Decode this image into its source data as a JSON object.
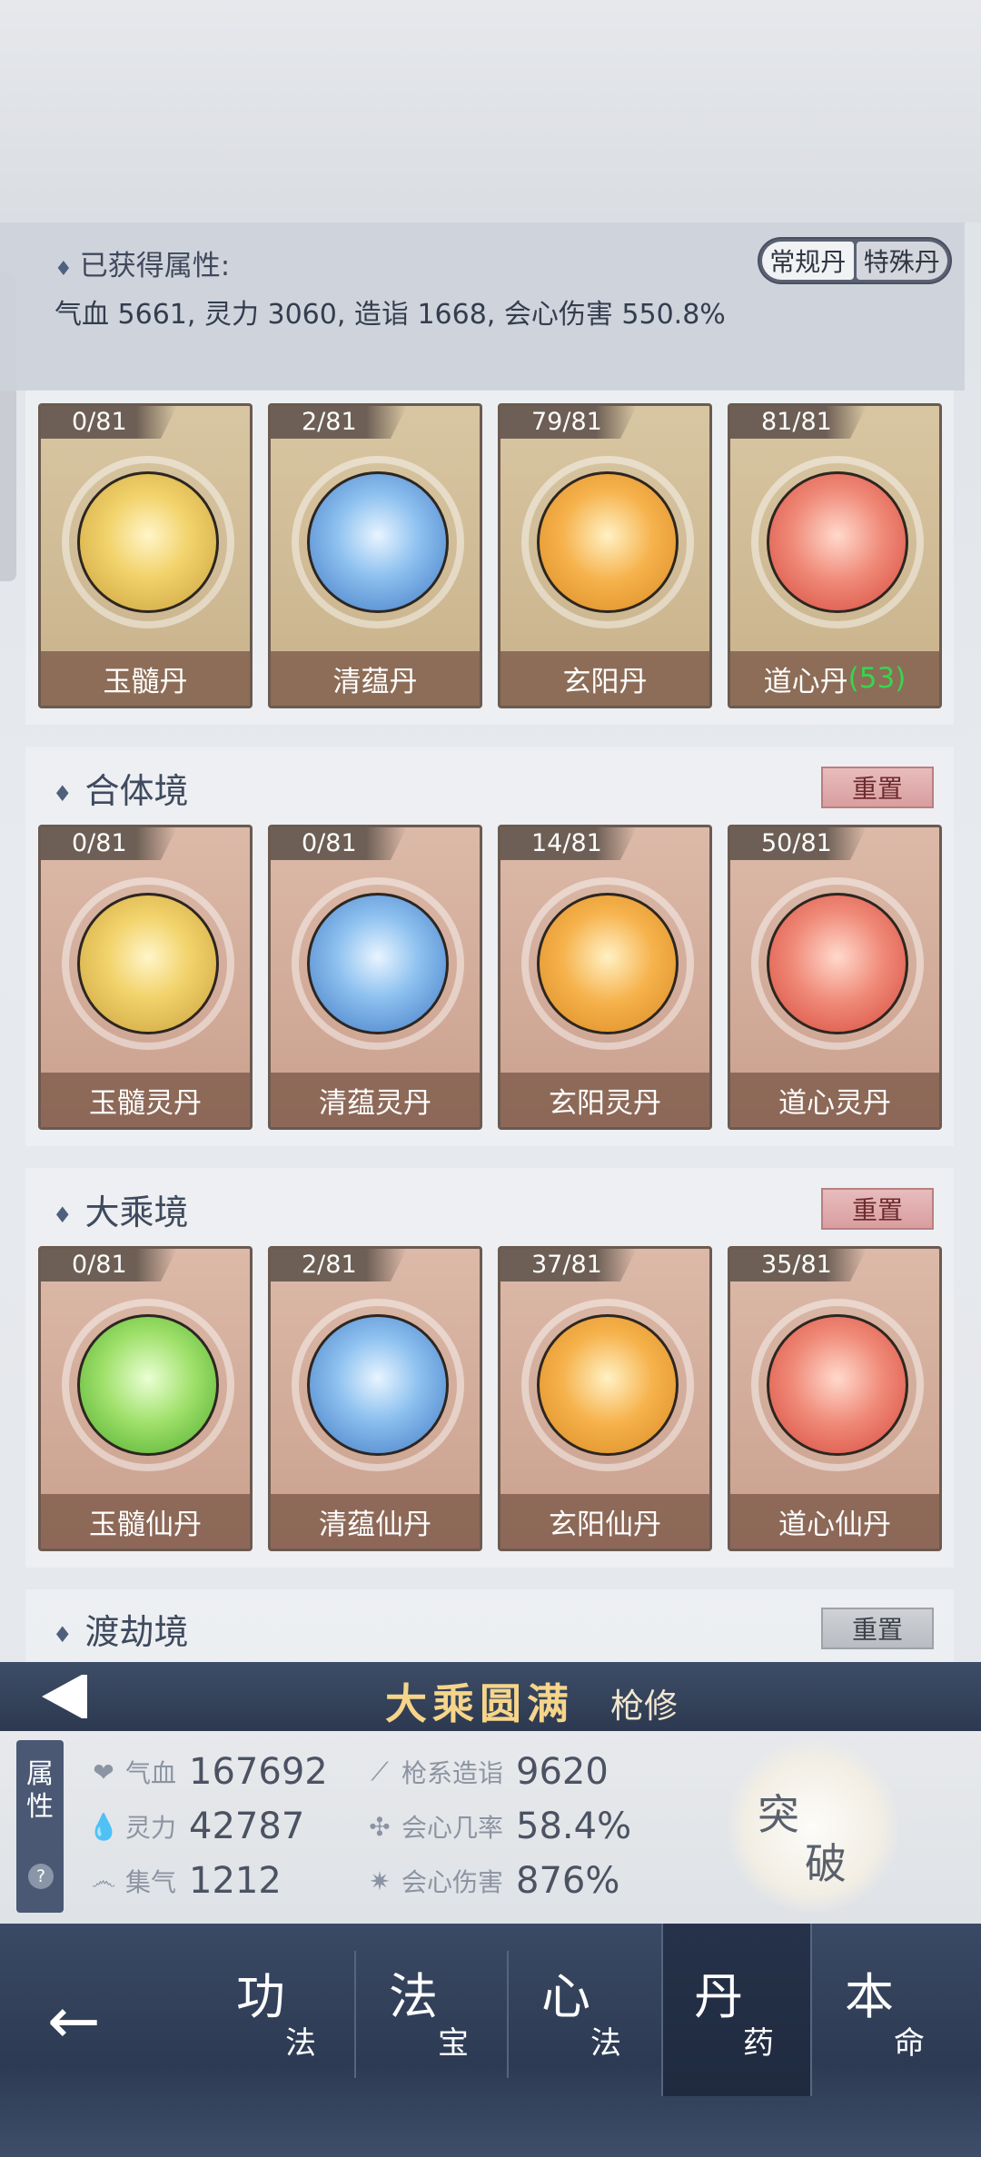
{
  "attributes": {
    "title": "已获得属性:",
    "text": "气血 5661, 灵力 3060, 造诣 1668, 会心伤害 550.8%",
    "tabs": [
      "常规丹",
      "特殊丹"
    ]
  },
  "top_cards": [
    {
      "count": "0/81",
      "name": "玉髓丹",
      "extra": "",
      "color": "gold"
    },
    {
      "count": "2/81",
      "name": "清蕴丹",
      "extra": "",
      "color": "blue"
    },
    {
      "count": "79/81",
      "name": "玄阳丹",
      "extra": "",
      "color": "orange"
    },
    {
      "count": "81/81",
      "name": "道心丹",
      "extra": "(53)",
      "color": "red"
    }
  ],
  "sections": [
    {
      "title": "合体境",
      "reset": "重置",
      "cards": [
        {
          "count": "0/81",
          "name": "玉髓灵丹"
        },
        {
          "count": "0/81",
          "name": "清蕴灵丹"
        },
        {
          "count": "14/81",
          "name": "玄阳灵丹"
        },
        {
          "count": "50/81",
          "name": "道心灵丹"
        }
      ]
    },
    {
      "title": "大乘境",
      "reset": "重置",
      "cards": [
        {
          "count": "0/81",
          "name": "玉髓仙丹"
        },
        {
          "count": "2/81",
          "name": "清蕴仙丹"
        },
        {
          "count": "37/81",
          "name": "玄阳仙丹"
        },
        {
          "count": "35/81",
          "name": "道心仙丹"
        }
      ]
    },
    {
      "title": "渡劫境",
      "reset": "重置"
    }
  ],
  "realm": {
    "name": "大乘圆满",
    "class": "枪修"
  },
  "stats": {
    "tab_label": "属性",
    "help": "?",
    "left": [
      {
        "icon": "heart-icon",
        "label": "气血",
        "value": "167692"
      },
      {
        "icon": "drop-icon",
        "label": "灵力",
        "value": "42787"
      },
      {
        "icon": "swirl-icon",
        "label": "集气",
        "value": "1212"
      }
    ],
    "right": [
      {
        "icon": "spear-icon",
        "label": "枪系造诣",
        "value": "9620"
      },
      {
        "icon": "crit-icon",
        "label": "会心几率",
        "value": "58.4%"
      },
      {
        "icon": "burst-icon",
        "label": "会心伤害",
        "value": "876%"
      }
    ],
    "breakthrough": [
      "突",
      "破"
    ]
  },
  "nav": {
    "back": "←",
    "items": [
      {
        "big": "功",
        "small": "法"
      },
      {
        "big": "法",
        "small": "宝"
      },
      {
        "big": "心",
        "small": "法"
      },
      {
        "big": "丹",
        "small": "药"
      },
      {
        "big": "本",
        "small": "命"
      }
    ],
    "active_index": 3
  }
}
